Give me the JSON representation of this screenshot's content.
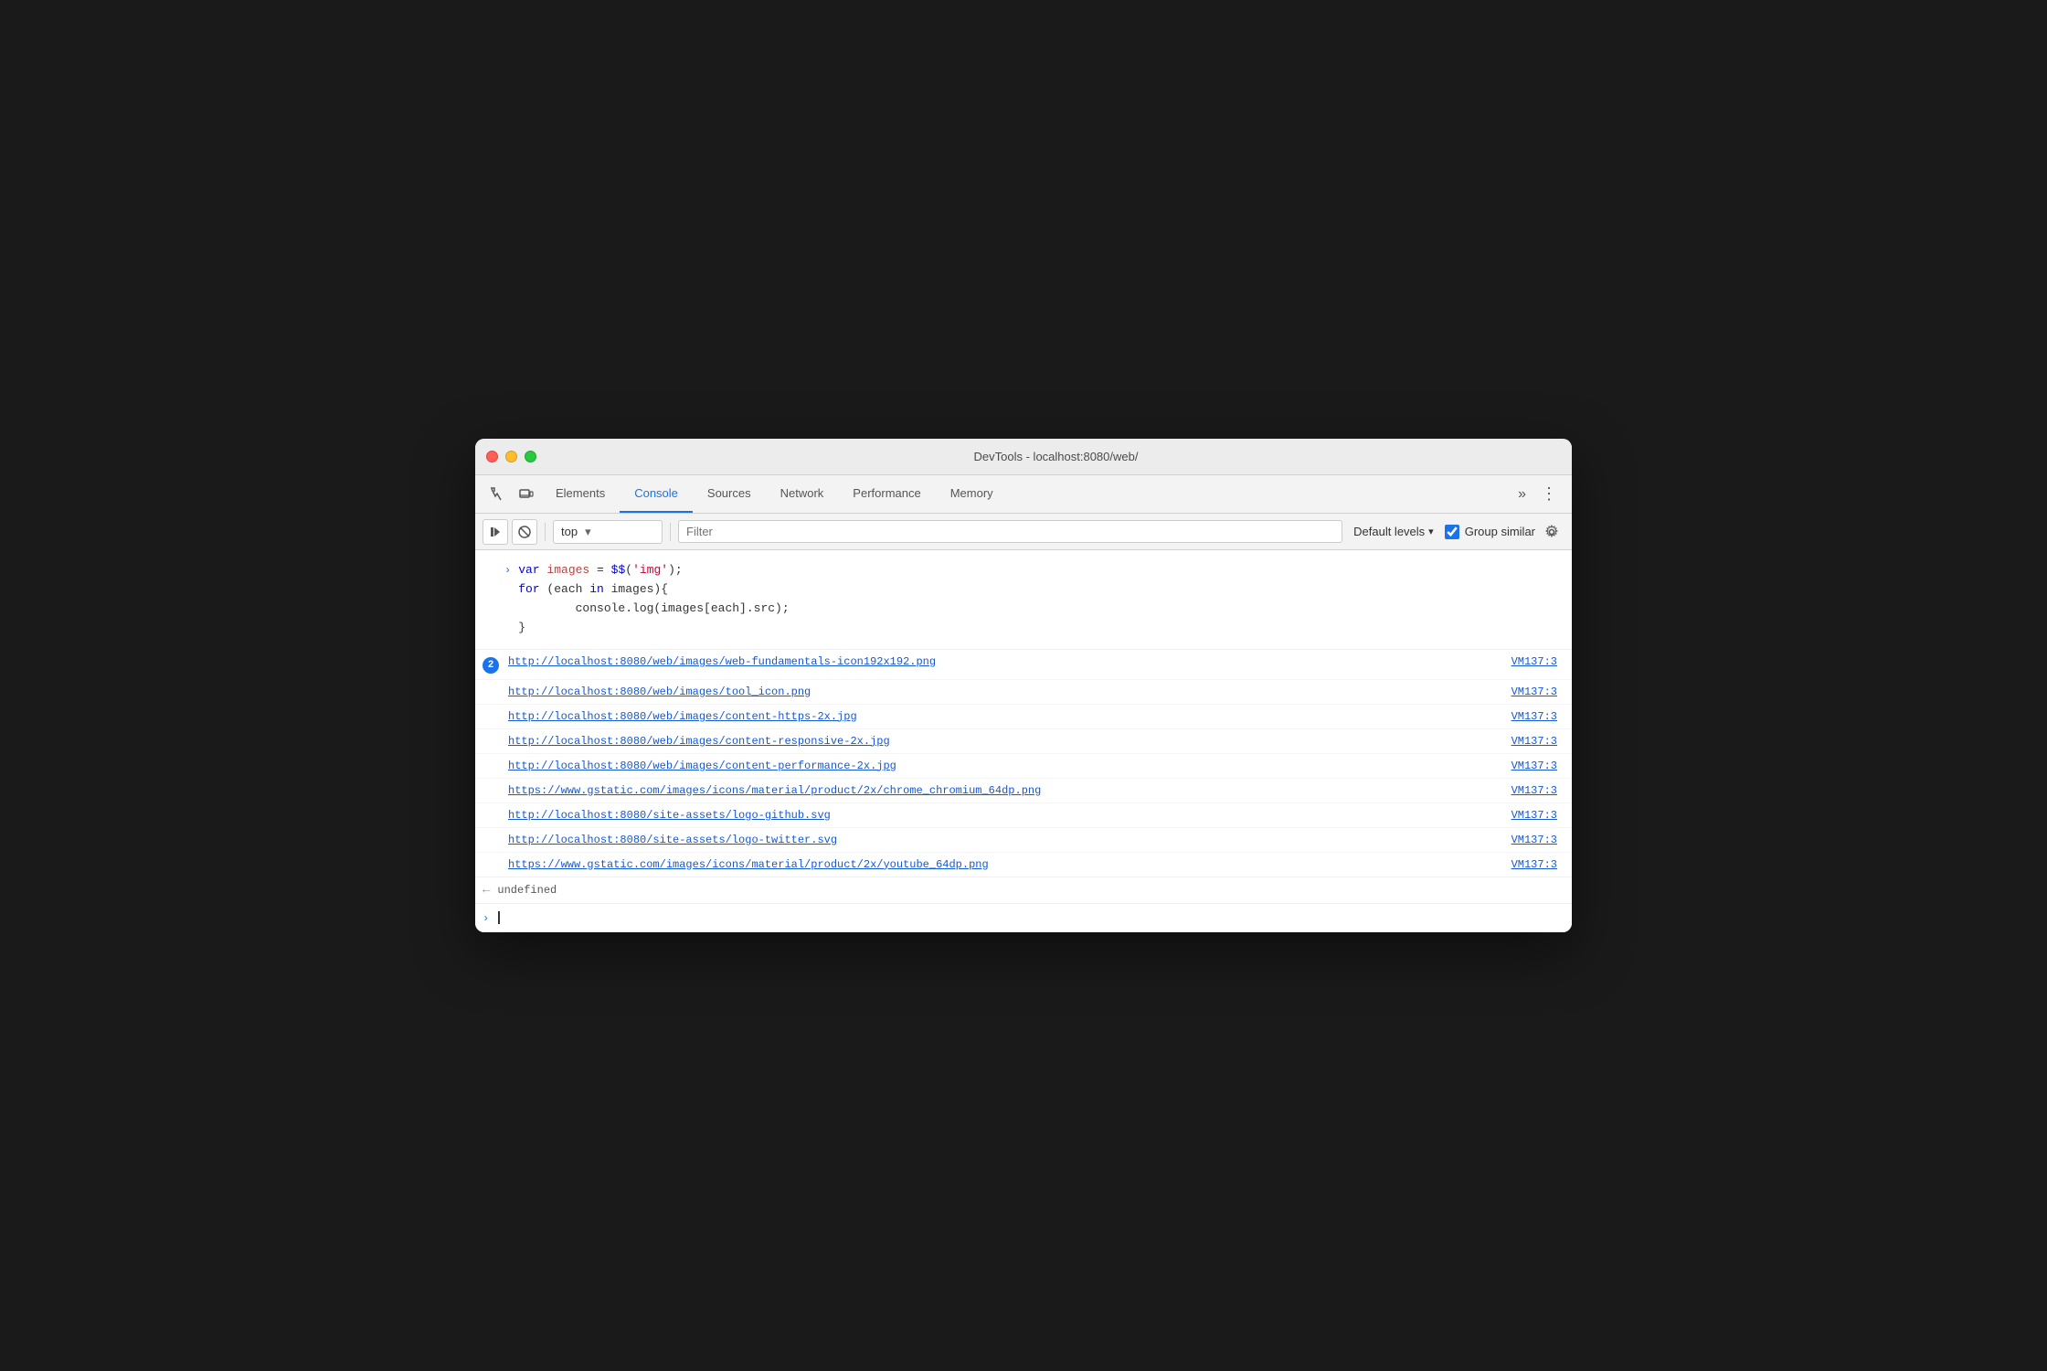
{
  "window": {
    "title": "DevTools - localhost:8080/web/"
  },
  "tabs": {
    "items": [
      {
        "id": "elements",
        "label": "Elements",
        "active": false
      },
      {
        "id": "console",
        "label": "Console",
        "active": true
      },
      {
        "id": "sources",
        "label": "Sources",
        "active": false
      },
      {
        "id": "network",
        "label": "Network",
        "active": false
      },
      {
        "id": "performance",
        "label": "Performance",
        "active": false
      },
      {
        "id": "memory",
        "label": "Memory",
        "active": false
      }
    ],
    "more_label": "»",
    "menu_label": "⋮"
  },
  "toolbar": {
    "run_script_label": "▶",
    "clear_label": "🚫",
    "context_value": "top",
    "filter_placeholder": "Filter",
    "levels_label": "Default levels",
    "levels_arrow": "▾",
    "group_similar_label": "Group similar",
    "settings_label": "⚙"
  },
  "console": {
    "code_lines": [
      "var images = $$('img');",
      "for (each in images){",
      "        console.log(images[each].src);",
      "}"
    ],
    "log_entries": [
      {
        "count": 2,
        "url": "http://localhost:8080/web/images/web-fundamentals-icon192x192.png",
        "source": "VM137:3",
        "indented": false
      },
      {
        "url": "http://localhost:8080/web/images/tool_icon.png",
        "source": "VM137:3",
        "indented": true
      },
      {
        "url": "http://localhost:8080/web/images/content-https-2x.jpg",
        "source": "VM137:3",
        "indented": true
      },
      {
        "url": "http://localhost:8080/web/images/content-responsive-2x.jpg",
        "source": "VM137:3",
        "indented": true
      },
      {
        "url": "http://localhost:8080/web/images/content-performance-2x.jpg",
        "source": "VM137:3",
        "indented": true
      },
      {
        "url": "https://www.gstatic.com/images/icons/material/product/2x/chrome_chromium_64dp.png",
        "source": "VM137:3",
        "indented": true
      },
      {
        "url": "http://localhost:8080/site-assets/logo-github.svg",
        "source": "VM137:3",
        "indented": true
      },
      {
        "url": "http://localhost:8080/site-assets/logo-twitter.svg",
        "source": "VM137:3",
        "indented": true
      },
      {
        "url": "https://www.gstatic.com/images/icons/material/product/2x/youtube_64dp.png",
        "source": "VM137:3",
        "indented": true
      }
    ],
    "result_label": "undefined",
    "result_arrow": "←"
  }
}
